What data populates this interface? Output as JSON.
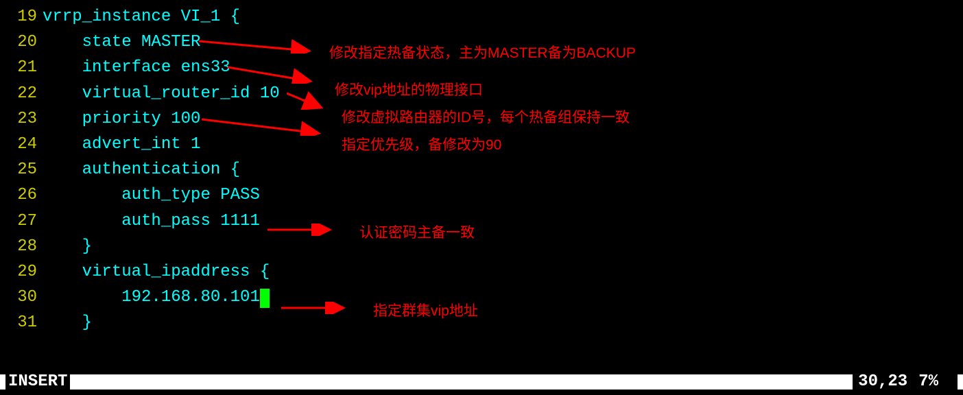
{
  "lines": [
    {
      "num": "19",
      "text": "vrrp_instance VI_1 {"
    },
    {
      "num": "20",
      "text": "    state MASTER"
    },
    {
      "num": "21",
      "text": "    interface ens33"
    },
    {
      "num": "22",
      "text": "    virtual_router_id 10"
    },
    {
      "num": "23",
      "text": "    priority 100"
    },
    {
      "num": "24",
      "text": "    advert_int 1"
    },
    {
      "num": "25",
      "text": "    authentication {"
    },
    {
      "num": "26",
      "text": "        auth_type PASS"
    },
    {
      "num": "27",
      "text": "        auth_pass 1111"
    },
    {
      "num": "28",
      "text": "    }"
    },
    {
      "num": "29",
      "text": "    virtual_ipaddress {"
    },
    {
      "num": "30",
      "text": "        192.168.80.101",
      "cursor": true
    },
    {
      "num": "31",
      "text": "    }"
    }
  ],
  "annotations": {
    "state": "修改指定热备状态，主为MASTER备为BACKUP",
    "interface": "修改vip地址的物理接口",
    "router_id": "修改虚拟路由器的ID号，每个热备组保持一致",
    "priority": "指定优先级，备修改为90",
    "auth_pass": "认证密码主备一致",
    "vip": "指定群集vip地址"
  },
  "status": {
    "mode": "INSERT",
    "position": "30,23",
    "percent": "7%"
  }
}
